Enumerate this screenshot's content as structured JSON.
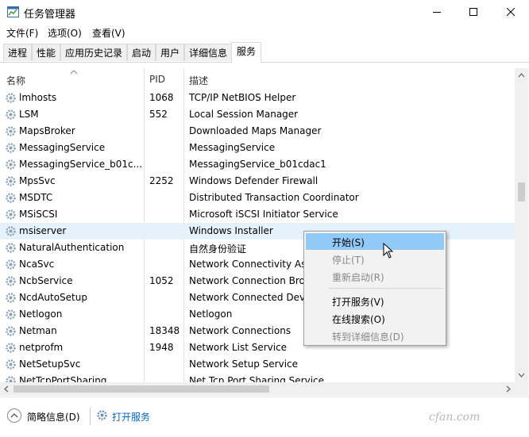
{
  "window": {
    "title": "任务管理器"
  },
  "menu": [
    "文件(F)",
    "选项(O)",
    "查看(V)"
  ],
  "tabs": [
    "进程",
    "性能",
    "应用历史记录",
    "启动",
    "用户",
    "详细信息",
    "服务"
  ],
  "active_tab": "服务",
  "columns": {
    "name": "名称",
    "pid": "PID",
    "desc": "描述"
  },
  "rows": [
    {
      "name": "lmhosts",
      "pid": "1068",
      "desc": "TCP/IP NetBIOS Helper"
    },
    {
      "name": "LSM",
      "pid": "552",
      "desc": "Local Session Manager"
    },
    {
      "name": "MapsBroker",
      "pid": "",
      "desc": "Downloaded Maps Manager"
    },
    {
      "name": "MessagingService",
      "pid": "",
      "desc": "MessagingService"
    },
    {
      "name": "MessagingService_b01c...",
      "pid": "",
      "desc": "MessagingService_b01cdac1"
    },
    {
      "name": "MpsSvc",
      "pid": "2252",
      "desc": "Windows Defender Firewall"
    },
    {
      "name": "MSDTC",
      "pid": "",
      "desc": "Distributed Transaction Coordinator"
    },
    {
      "name": "MSiSCSI",
      "pid": "",
      "desc": "Microsoft iSCSI Initiator Service"
    },
    {
      "name": "msiserver",
      "pid": "",
      "desc": "Windows Installer"
    },
    {
      "name": "NaturalAuthentication",
      "pid": "",
      "desc": "自然身份验证"
    },
    {
      "name": "NcaSvc",
      "pid": "",
      "desc": "Network Connectivity Ass"
    },
    {
      "name": "NcbService",
      "pid": "1052",
      "desc": "Network Connection Bro"
    },
    {
      "name": "NcdAutoSetup",
      "pid": "",
      "desc": "Network Connected Devi"
    },
    {
      "name": "Netlogon",
      "pid": "",
      "desc": "Netlogon"
    },
    {
      "name": "Netman",
      "pid": "18348",
      "desc": "Network Connections"
    },
    {
      "name": "netprofm",
      "pid": "1948",
      "desc": "Network List Service"
    },
    {
      "name": "NetSetupSvc",
      "pid": "",
      "desc": "Network Setup Service"
    },
    {
      "name": "NetTcpPortSharing",
      "pid": "",
      "desc": "Net.Tcp Port Sharing Service"
    }
  ],
  "selected_row": "msiserver",
  "context_menu": {
    "items": [
      {
        "label": "开始(S)",
        "state": "hover"
      },
      {
        "label": "停止(T)",
        "state": "disabled"
      },
      {
        "label": "重新启动(R)",
        "state": "disabled"
      },
      {
        "label": "打开服务(V)",
        "state": "enabled"
      },
      {
        "label": "在线搜索(O)",
        "state": "enabled"
      },
      {
        "label": "转到详细信息(D)",
        "state": "disabled"
      }
    ]
  },
  "footer": {
    "collapse_label": "简略信息(D)",
    "open_services_link": "打开服务"
  },
  "watermark": "cfan.com",
  "colors": {
    "selected_row": "#e5f1fb",
    "menu_hover": "#91c9f7",
    "link": "#0066cc"
  }
}
